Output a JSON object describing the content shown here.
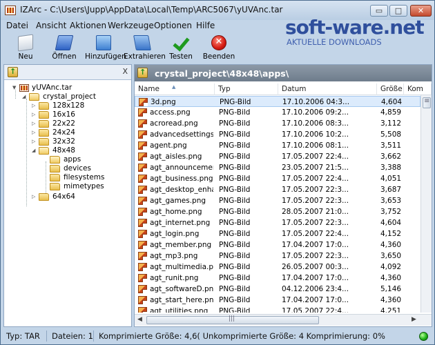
{
  "window": {
    "title": "IZArc - C:\\Users\\Jupp\\AppData\\Local\\Temp\\ARC5067\\yUVAnc.tar",
    "controls": {
      "minimize": "▭",
      "maximize": "□",
      "close": "✕"
    }
  },
  "menu": [
    "Datei",
    "Ansicht",
    "Aktionen",
    "Werkzeuge",
    "Optionen",
    "Hilfe"
  ],
  "watermark": {
    "logo": "soft-ware.net",
    "subtitle": "AKTUELLE DOWNLOADS"
  },
  "toolbar": [
    {
      "label": "Neu",
      "icon": "new-archive-icon"
    },
    {
      "label": "Öffnen",
      "icon": "open-archive-icon"
    },
    {
      "label": "Hinzufügen",
      "icon": "add-files-icon"
    },
    {
      "label": "Extrahieren",
      "icon": "extract-icon"
    },
    {
      "label": "Testen",
      "icon": "checkmark-icon"
    },
    {
      "label": "Beenden",
      "icon": "exit-icon"
    }
  ],
  "tree": {
    "close_label": "X",
    "nodes": [
      {
        "label": "yUVAnc.tar",
        "level": 0,
        "type": "archive",
        "expanded": true
      },
      {
        "label": "crystal_project",
        "level": 1,
        "type": "folder",
        "expanded": true
      },
      {
        "label": "128x128",
        "level": 2,
        "type": "folder",
        "expanded": false
      },
      {
        "label": "16x16",
        "level": 2,
        "type": "folder",
        "expanded": false
      },
      {
        "label": "22x22",
        "level": 2,
        "type": "folder",
        "expanded": false
      },
      {
        "label": "24x24",
        "level": 2,
        "type": "folder",
        "expanded": false
      },
      {
        "label": "32x32",
        "level": 2,
        "type": "folder",
        "expanded": false
      },
      {
        "label": "48x48",
        "level": 2,
        "type": "folder",
        "expanded": true
      },
      {
        "label": "apps",
        "level": 3,
        "type": "folder",
        "expanded": false,
        "selected": true
      },
      {
        "label": "devices",
        "level": 3,
        "type": "folder",
        "expanded": false
      },
      {
        "label": "filesystems",
        "level": 3,
        "type": "folder",
        "expanded": false
      },
      {
        "label": "mimetypes",
        "level": 3,
        "type": "folder",
        "expanded": false
      },
      {
        "label": "64x64",
        "level": 2,
        "type": "folder",
        "expanded": false
      }
    ]
  },
  "content": {
    "path": "crystal_project\\48x48\\apps\\",
    "columns": [
      "Name",
      "Typ",
      "Datum",
      "Größe",
      "Kom"
    ],
    "files": [
      [
        "3d.png",
        "PNG-Bild",
        "17.10.2006 04:3...",
        "4,604"
      ],
      [
        "access.png",
        "PNG-Bild",
        "17.10.2006 09:2...",
        "4,859"
      ],
      [
        "acroread.png",
        "PNG-Bild",
        "17.10.2006 08:3...",
        "3,112"
      ],
      [
        "advancedsettings.p...",
        "PNG-Bild",
        "17.10.2006 10:2...",
        "5,508"
      ],
      [
        "agent.png",
        "PNG-Bild",
        "17.10.2006 08:1...",
        "3,511"
      ],
      [
        "agt_aisles.png",
        "PNG-Bild",
        "17.05.2007 22:4...",
        "3,662"
      ],
      [
        "agt_announcement...",
        "PNG-Bild",
        "23.05.2007 21:5...",
        "3,388"
      ],
      [
        "agt_business.png",
        "PNG-Bild",
        "17.05.2007 22:4...",
        "4,051"
      ],
      [
        "agt_desktop_enha...",
        "PNG-Bild",
        "17.05.2007 22:3...",
        "3,687"
      ],
      [
        "agt_games.png",
        "PNG-Bild",
        "17.05.2007 22:3...",
        "3,653"
      ],
      [
        "agt_home.png",
        "PNG-Bild",
        "28.05.2007 21:0...",
        "3,752"
      ],
      [
        "agt_internet.png",
        "PNG-Bild",
        "17.05.2007 22:3...",
        "4,604"
      ],
      [
        "agt_login.png",
        "PNG-Bild",
        "17.05.2007 22:4...",
        "4,152"
      ],
      [
        "agt_member.png",
        "PNG-Bild",
        "17.04.2007 17:0...",
        "4,360"
      ],
      [
        "agt_mp3.png",
        "PNG-Bild",
        "17.05.2007 22:3...",
        "3,650"
      ],
      [
        "agt_multimedia.png",
        "PNG-Bild",
        "26.05.2007 00:3...",
        "4,092"
      ],
      [
        "agt_runit.png",
        "PNG-Bild",
        "17.04.2007 17:0...",
        "4,360"
      ],
      [
        "agt_softwareD.png",
        "PNG-Bild",
        "04.12.2006 23:4...",
        "5,146"
      ],
      [
        "agt_start_here.png",
        "PNG-Bild",
        "17.04.2007 17:0...",
        "4,360"
      ],
      [
        "agt_utilities.png",
        "PNG-Bild",
        "17.05.2007 22:4...",
        "4,251"
      ]
    ]
  },
  "statusbar": {
    "type": "Typ: TAR",
    "files": "Dateien: 1",
    "summary": "Komprimierte Größe: 4,6( Unkomprimierte Größe: 4 Komprimierung: 0%"
  },
  "colors": {
    "accent": "#2f4f9c",
    "window_frame": "#c3d5e8",
    "selection": "#dcebfc",
    "path_bar": "#7d8a99"
  }
}
